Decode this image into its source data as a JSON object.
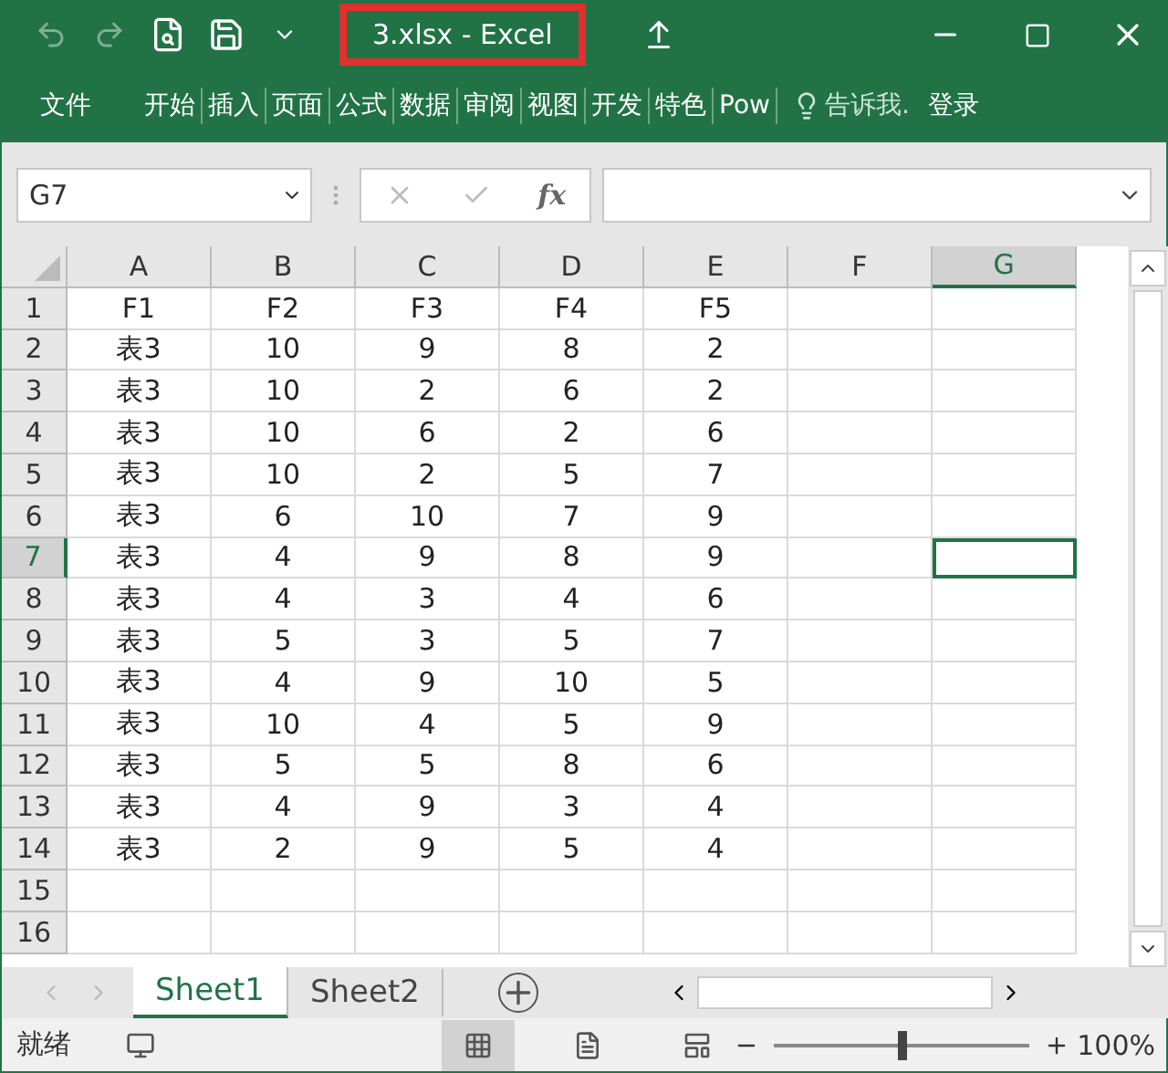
{
  "title_bar": {
    "title": "3.xlsx - Excel"
  },
  "ribbon_tabs": [
    {
      "label": "文件"
    },
    {
      "label": "开始"
    },
    {
      "label": "插入"
    },
    {
      "label": "页面"
    },
    {
      "label": "公式"
    },
    {
      "label": "数据"
    },
    {
      "label": "审阅"
    },
    {
      "label": "视图"
    },
    {
      "label": "开发"
    },
    {
      "label": "特色"
    },
    {
      "label": "Pow"
    }
  ],
  "tell_me": "告诉我.",
  "sign_in": "登录",
  "name_box": "G7",
  "function_button": "fx",
  "columns": [
    {
      "label": "A",
      "selected": false
    },
    {
      "label": "B",
      "selected": false
    },
    {
      "label": "C",
      "selected": false
    },
    {
      "label": "D",
      "selected": false
    },
    {
      "label": "E",
      "selected": false
    },
    {
      "label": "F",
      "selected": false
    },
    {
      "label": "G",
      "selected": true
    }
  ],
  "rows": [
    {
      "label": "1",
      "selected": false,
      "cells": [
        "F1",
        "F2",
        "F3",
        "F4",
        "F5"
      ]
    },
    {
      "label": "2",
      "selected": false,
      "cells": [
        "表3",
        "10",
        "9",
        "8",
        "2"
      ]
    },
    {
      "label": "3",
      "selected": false,
      "cells": [
        "表3",
        "10",
        "2",
        "6",
        "2"
      ]
    },
    {
      "label": "4",
      "selected": false,
      "cells": [
        "表3",
        "10",
        "6",
        "2",
        "6"
      ]
    },
    {
      "label": "5",
      "selected": false,
      "cells": [
        "表3",
        "10",
        "2",
        "5",
        "7"
      ]
    },
    {
      "label": "6",
      "selected": false,
      "cells": [
        "表3",
        "6",
        "10",
        "7",
        "9"
      ]
    },
    {
      "label": "7",
      "selected": true,
      "cells": [
        "表3",
        "4",
        "9",
        "8",
        "9"
      ]
    },
    {
      "label": "8",
      "selected": false,
      "cells": [
        "表3",
        "4",
        "3",
        "4",
        "6"
      ]
    },
    {
      "label": "9",
      "selected": false,
      "cells": [
        "表3",
        "5",
        "3",
        "5",
        "7"
      ]
    },
    {
      "label": "10",
      "selected": false,
      "cells": [
        "表3",
        "4",
        "9",
        "10",
        "5"
      ]
    },
    {
      "label": "11",
      "selected": false,
      "cells": [
        "表3",
        "10",
        "4",
        "5",
        "9"
      ]
    },
    {
      "label": "12",
      "selected": false,
      "cells": [
        "表3",
        "5",
        "5",
        "8",
        "6"
      ]
    },
    {
      "label": "13",
      "selected": false,
      "cells": [
        "表3",
        "4",
        "9",
        "3",
        "4"
      ]
    },
    {
      "label": "14",
      "selected": false,
      "cells": [
        "表3",
        "2",
        "9",
        "5",
        "4"
      ]
    },
    {
      "label": "15",
      "selected": false
    },
    {
      "label": "16",
      "selected": false
    }
  ],
  "sheet_tabs": [
    {
      "label": "Sheet1",
      "selected": true
    },
    {
      "label": "Sheet2",
      "selected": false
    }
  ],
  "status_bar": {
    "status": "就绪",
    "zoom": "100%",
    "zoom_slider": {
      "level": 0.5
    }
  }
}
